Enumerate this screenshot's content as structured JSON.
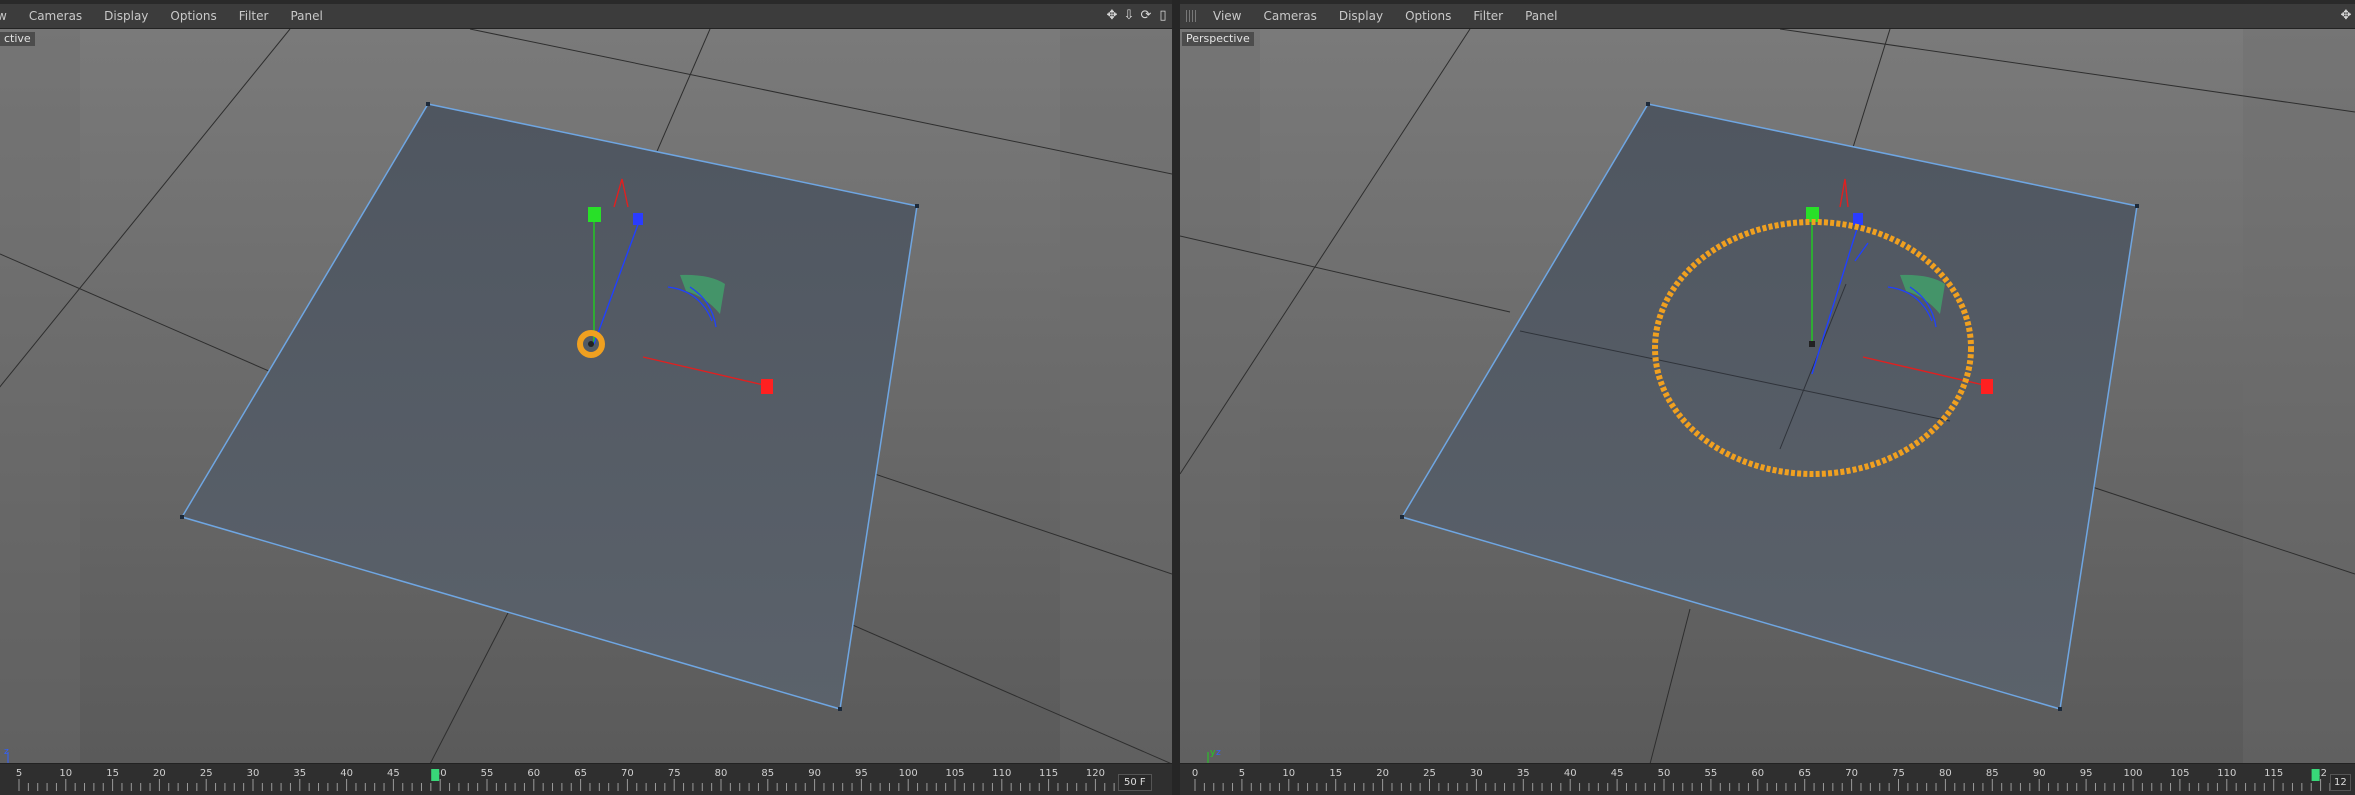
{
  "left_viewport": {
    "menu": [
      "w",
      "Cameras",
      "Display",
      "Options",
      "Filter",
      "Panel"
    ],
    "view_label": "ctive",
    "nav_icons": [
      "move-icon",
      "zoom-icon",
      "rotate-icon",
      "maximize-icon"
    ],
    "timeline": {
      "ticks": [
        "5",
        "10",
        "15",
        "20",
        "25",
        "30",
        "35",
        "40",
        "45",
        "50",
        "55",
        "60",
        "65",
        "70",
        "75",
        "80",
        "85",
        "90",
        "95",
        "100",
        "105",
        "110",
        "115",
        "120"
      ],
      "current_frame": "50 F"
    }
  },
  "right_viewport": {
    "menu": [
      "View",
      "Cameras",
      "Display",
      "Options",
      "Filter",
      "Panel"
    ],
    "view_label": "Perspective",
    "nav_icons": [
      "move-icon"
    ],
    "timeline": {
      "ticks": [
        "0",
        "5",
        "10",
        "15",
        "20",
        "25",
        "30",
        "35",
        "40",
        "45",
        "50",
        "55",
        "60",
        "65",
        "70",
        "75",
        "80",
        "85",
        "90",
        "95",
        "100",
        "105",
        "110",
        "115",
        "12"
      ],
      "current_frame": "12"
    }
  },
  "colors": {
    "plane_fill": "#535a63",
    "plane_edge": "#6fa6e2",
    "selection": "#f0a020",
    "axis_x": "#e02020",
    "axis_y": "#20d020",
    "axis_z": "#2040ff"
  }
}
